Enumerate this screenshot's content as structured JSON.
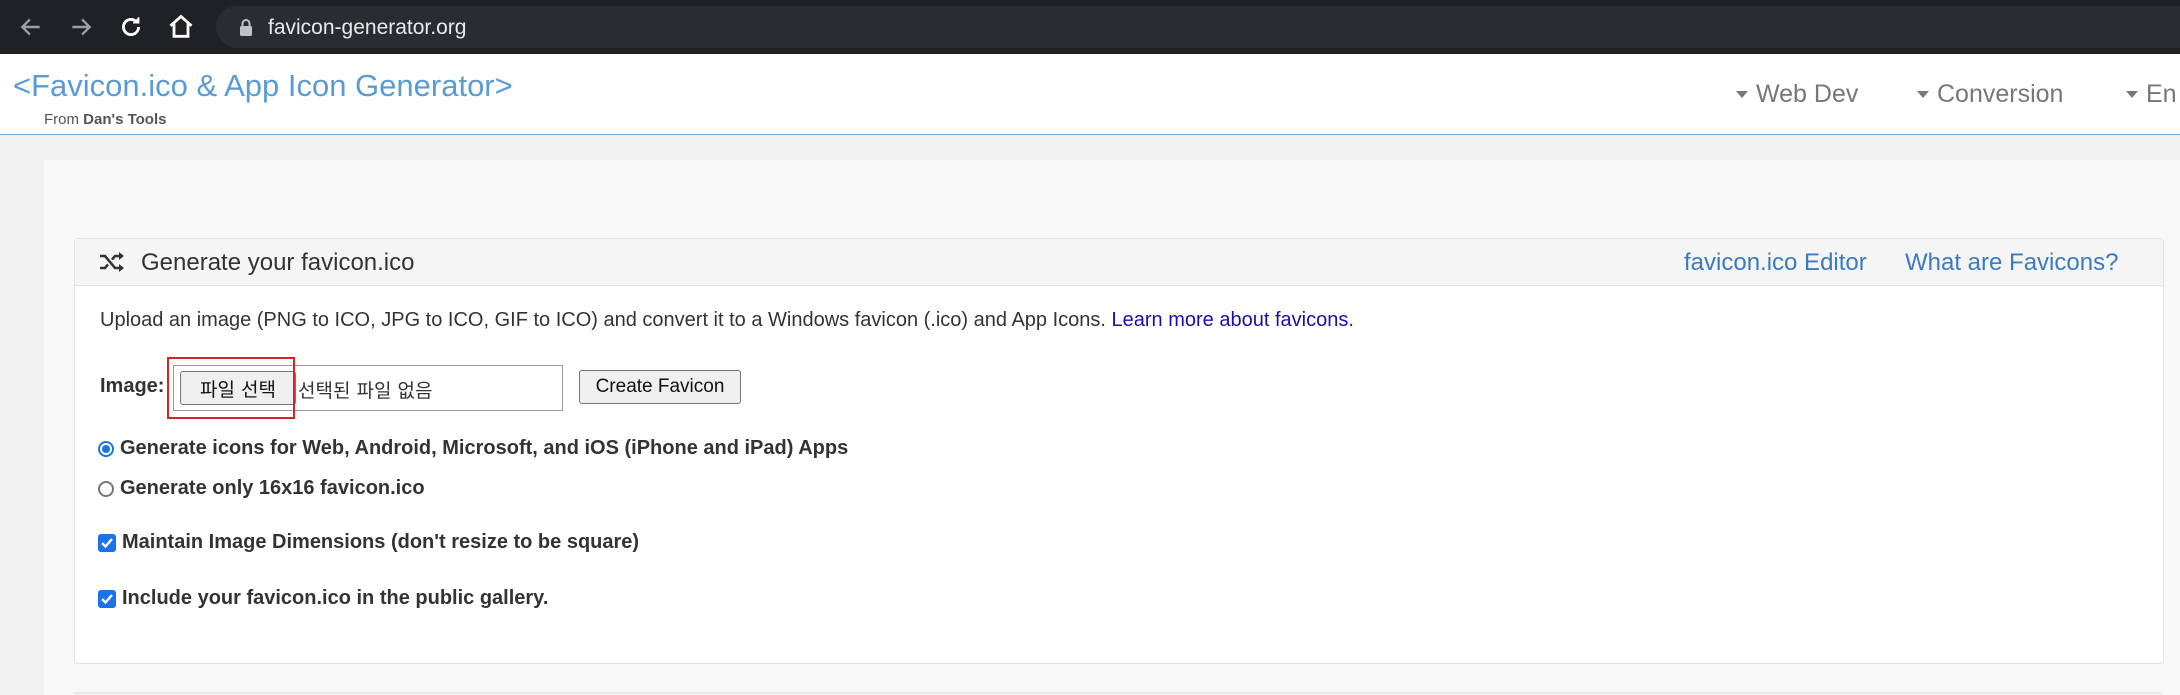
{
  "browser": {
    "url": "favicon-generator.org"
  },
  "header": {
    "title": "<Favicon.ico & App Icon Generator>",
    "from_label": "From",
    "from_name": "Dan's Tools",
    "menu": [
      "Web Dev",
      "Conversion",
      "En"
    ]
  },
  "panel": {
    "title": "Generate your favicon.ico",
    "links": [
      "favicon.ico Editor",
      "What are Favicons?"
    ],
    "description": "Upload an image (PNG to ICO, JPG to ICO, GIF to ICO) and convert it to a Windows favicon (.ico) and App Icons.",
    "learn_more": "Learn more about favicons",
    "learn_more_suffix": ".",
    "image_label": "Image:",
    "file_button": "파일 선택",
    "file_status": "선택된 파일 없음",
    "create_button": "Create Favicon",
    "options": {
      "radio_all": "Generate icons for Web, Android, Microsoft, and iOS (iPhone and iPad) Apps",
      "radio_16": "Generate only 16x16 favicon.ico",
      "maintain_dims": "Maintain Image Dimensions (don't resize to be square)",
      "public_gallery": "Include your favicon.ico in the public gallery."
    }
  },
  "colors": {
    "accent": "#1a73e8",
    "brand": "#5b9bd5",
    "highlight": "#d9232b"
  }
}
